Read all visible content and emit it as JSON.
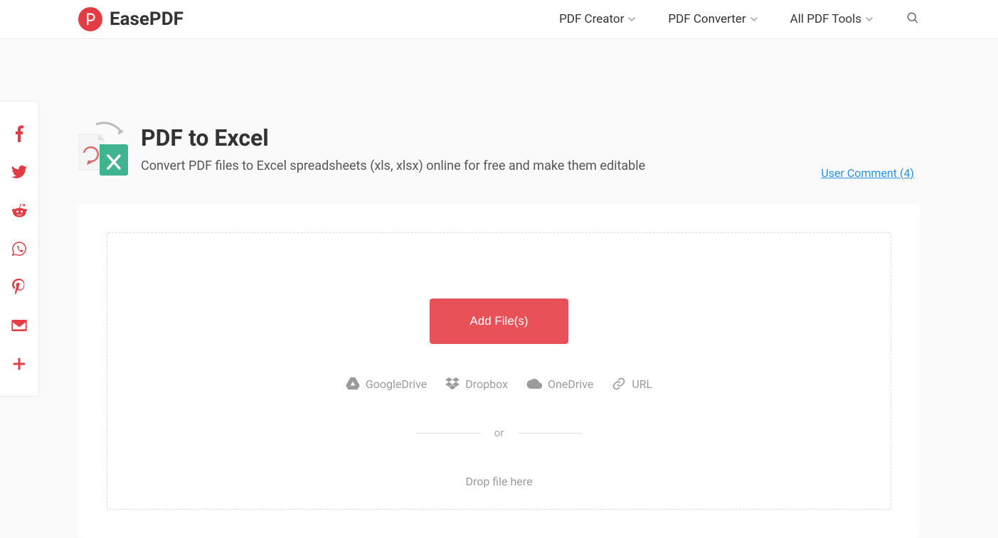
{
  "brand": "EasePDF",
  "nav": {
    "creator": "PDF Creator",
    "converter": "PDF Converter",
    "tools": "All PDF Tools"
  },
  "page": {
    "title": "PDF to Excel",
    "subtitle": "Convert PDF files to Excel spreadsheets (xls, xlsx) online for free and make them editable",
    "comments": "User Comment (4)"
  },
  "drop": {
    "add_button": "Add File(s)",
    "sources": {
      "google": "GoogleDrive",
      "dropbox": "Dropbox",
      "onedrive": "OneDrive",
      "url": "URL"
    },
    "or": "or",
    "hint": "Drop file here"
  }
}
